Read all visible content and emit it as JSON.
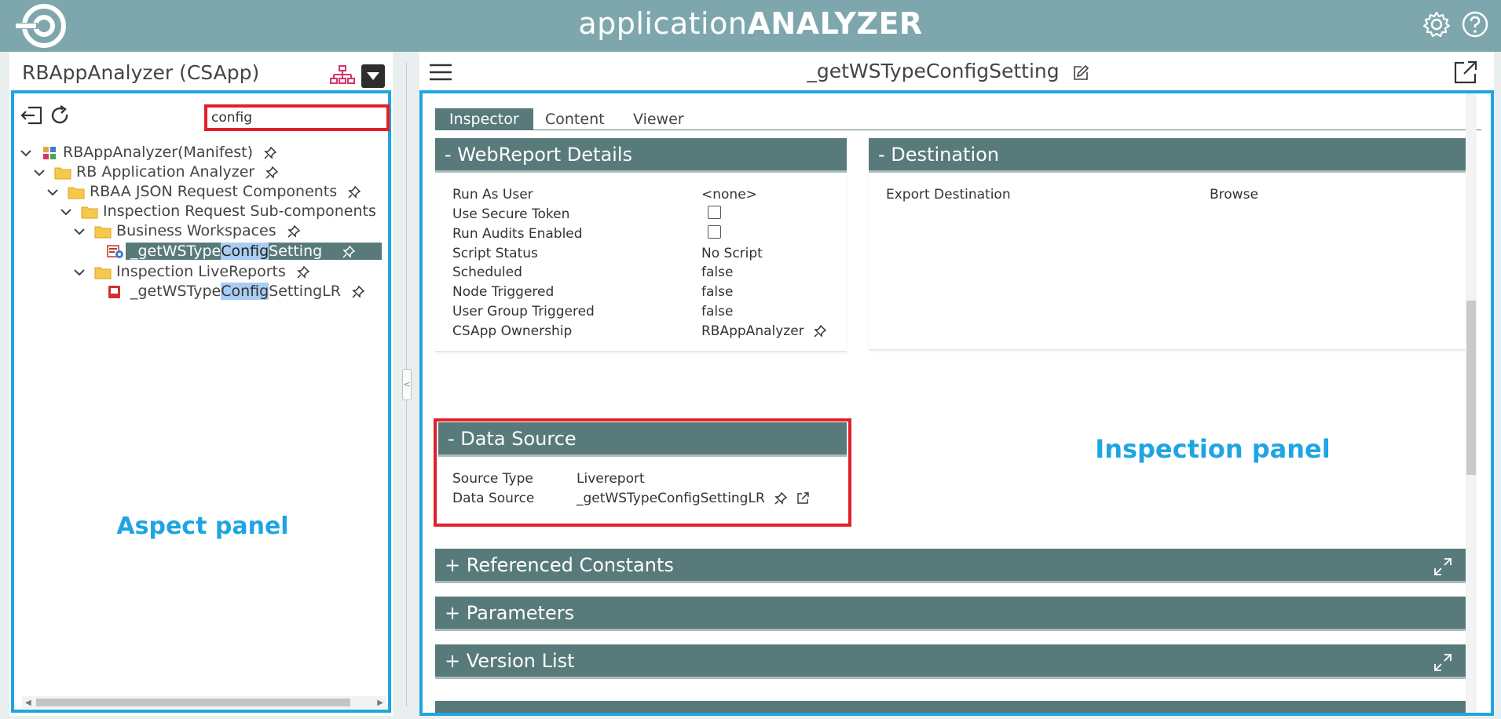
{
  "app": {
    "title_light": "application",
    "title_bold": "ANALYZER"
  },
  "aspect": {
    "title": "RBAppAnalyzer (CSApp)",
    "search_value": "config",
    "label": "Aspect panel",
    "tree": [
      {
        "label": "RBAppAnalyzer(Manifest)"
      },
      {
        "label": "RB Application Analyzer"
      },
      {
        "label": "RBAA JSON Request Components"
      },
      {
        "label": "Inspection Request Sub-components"
      },
      {
        "label": "Business Workspaces"
      },
      {
        "pre": "_getWSType",
        "match": "Config",
        "post": "Setting"
      },
      {
        "label": "Inspection LiveReports"
      },
      {
        "pre": "_getWSType",
        "match": "Config",
        "post": "SettingLR"
      }
    ]
  },
  "inspect": {
    "title": "_getWSTypeConfigSetting",
    "label": "Inspection panel",
    "tabs": [
      "Inspector",
      "Content",
      "Viewer"
    ],
    "webreport": {
      "header": "- WebReport Details",
      "rows": [
        {
          "label": "Run As User",
          "value": "<none>"
        },
        {
          "label": "Use Secure Token",
          "value": ""
        },
        {
          "label": "Run Audits Enabled",
          "value": ""
        },
        {
          "label": "Script Status",
          "value": "No Script"
        },
        {
          "label": "Scheduled",
          "value": "false"
        },
        {
          "label": "Node Triggered",
          "value": "false"
        },
        {
          "label": "User Group Triggered",
          "value": "false"
        },
        {
          "label": "CSApp Ownership",
          "value": "RBAppAnalyzer"
        }
      ]
    },
    "destination": {
      "header": "- Destination",
      "label": "Export Destination",
      "value": "Browse"
    },
    "datasource": {
      "header": "- Data Source",
      "rows": [
        {
          "label": "Source Type",
          "value": "Livereport"
        },
        {
          "label": "Data Source",
          "value": "_getWSTypeConfigSettingLR"
        }
      ]
    },
    "collapsed": [
      "+ Referenced Constants",
      "+ Parameters",
      "+ Version List"
    ]
  },
  "colors": {
    "topbar": "#7ea7ad",
    "section": "#587a7a",
    "accent_blue": "#1fa5e1",
    "accent_red": "#e0202a",
    "highlight": "#a8cdf2"
  }
}
